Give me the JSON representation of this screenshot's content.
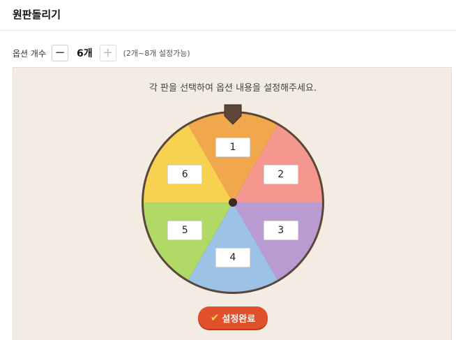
{
  "header": {
    "title": "원판돌리기"
  },
  "options": {
    "label": "옵션 개수",
    "minus_icon": "minus-icon",
    "plus_icon": "plus-icon",
    "count": "6개",
    "range_note": "(2개~8개 설정가능)"
  },
  "board": {
    "instruction": "각 판을 선택하여 옵션 내용을 설정해주세요.",
    "colors": {
      "panel_bg": "#f3ece2",
      "rim": "#5b4638",
      "pointer": "#5b4638"
    },
    "slices": [
      {
        "value": "1",
        "color": "#f1a74b"
      },
      {
        "value": "2",
        "color": "#f5978f"
      },
      {
        "value": "3",
        "color": "#b99bd2"
      },
      {
        "value": "4",
        "color": "#9cc3e6"
      },
      {
        "value": "5",
        "color": "#b0d965"
      },
      {
        "value": "6",
        "color": "#f7d250"
      }
    ],
    "done_label": "설정완료",
    "done_icon": "check-icon"
  }
}
